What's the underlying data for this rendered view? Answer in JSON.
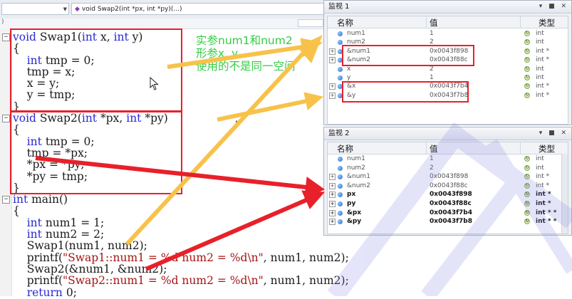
{
  "toolbar": {
    "left_combo": "",
    "function_combo": "void Swap2(int *px, int *py)(...)"
  },
  "code_lines": [
    {
      "t": "void Swap1(int x, int y)"
    },
    {
      "t": "{"
    },
    {
      "t": "    int tmp = 0;"
    },
    {
      "t": "    tmp = x;"
    },
    {
      "t": "    x = y;"
    },
    {
      "t": "    y = tmp;"
    },
    {
      "t": "}"
    },
    {
      "t": "void Swap2(int *px, int *py)"
    },
    {
      "t": "{"
    },
    {
      "t": "    int tmp = 0;"
    },
    {
      "t": "    tmp = *px;"
    },
    {
      "t": "    *px = *py;"
    },
    {
      "t": "    *py = tmp;"
    },
    {
      "t": "}"
    },
    {
      "t": "int main()"
    },
    {
      "t": "{"
    },
    {
      "t": "    int num1 = 1;"
    },
    {
      "t": "    int num2 = 2;"
    },
    {
      "t": "    Swap1(num1, num2);"
    },
    {
      "t": "    printf(\"Swap1::num1 = %d num2 = %d\\n\", num1, num2);"
    },
    {
      "t": "    Swap2(&num1, &num2);"
    },
    {
      "t": "    printf(\"Swap2::num1 = %d num2 = %d\\n\", num1, num2);"
    },
    {
      "t": "    return 0;"
    }
  ],
  "annotation": {
    "line1": "实参num1和num2",
    "line2": "形参x, y",
    "line3": "使用的不是同一空间"
  },
  "watch1": {
    "title": "监视 1",
    "col_name": "名称",
    "col_value": "值",
    "col_type": "类型",
    "rows": [
      {
        "exp": false,
        "name": "num1",
        "value": "1",
        "type": "int"
      },
      {
        "exp": false,
        "name": "num2",
        "value": "2",
        "type": "int"
      },
      {
        "exp": true,
        "name": "&num1",
        "value": "0x0043f898",
        "type": "int *"
      },
      {
        "exp": true,
        "name": "&num2",
        "value": "0x0043f88c",
        "type": "int *"
      },
      {
        "exp": false,
        "name": "x",
        "value": "2",
        "type": "int"
      },
      {
        "exp": false,
        "name": "y",
        "value": "1",
        "type": "int"
      },
      {
        "exp": true,
        "name": "&x",
        "value": "0x0043f7b4",
        "type": "int *"
      },
      {
        "exp": true,
        "name": "&y",
        "value": "0x0043f7b8",
        "type": "int *"
      }
    ]
  },
  "watch2": {
    "title": "监视 2",
    "col_name": "名称",
    "col_value": "值",
    "col_type": "类型",
    "rows": [
      {
        "exp": false,
        "name": "num1",
        "value": "1",
        "type": "int",
        "bold": false
      },
      {
        "exp": false,
        "name": "num2",
        "value": "2",
        "type": "int",
        "bold": false
      },
      {
        "exp": true,
        "name": "&num1",
        "value": "0x0043f898",
        "type": "int *",
        "bold": false
      },
      {
        "exp": true,
        "name": "&num2",
        "value": "0x0043f88c",
        "type": "int *",
        "bold": false
      },
      {
        "exp": true,
        "name": "px",
        "value": "0x0043f898",
        "type": "int *",
        "bold": true
      },
      {
        "exp": true,
        "name": "py",
        "value": "0x0043f88c",
        "type": "int *",
        "bold": true
      },
      {
        "exp": true,
        "name": "&px",
        "value": "0x0043f7b4",
        "type": "int * *",
        "bold": true
      },
      {
        "exp": true,
        "name": "&py",
        "value": "0x0043f7b8",
        "type": "int * *",
        "bold": true
      }
    ]
  },
  "colors": {
    "highlight_red": "#e8202a",
    "annotation_green": "#33cc44",
    "arrow_yellow": "#f8c24a",
    "keyword_blue": "#2a2acf"
  },
  "icons": [
    "combo-dropdown-icon",
    "function-icon",
    "collapse-icon",
    "expand-icon",
    "watch-variable-icon",
    "refresh-icon",
    "mouse-pointer-icon",
    "text-caret-icon"
  ]
}
